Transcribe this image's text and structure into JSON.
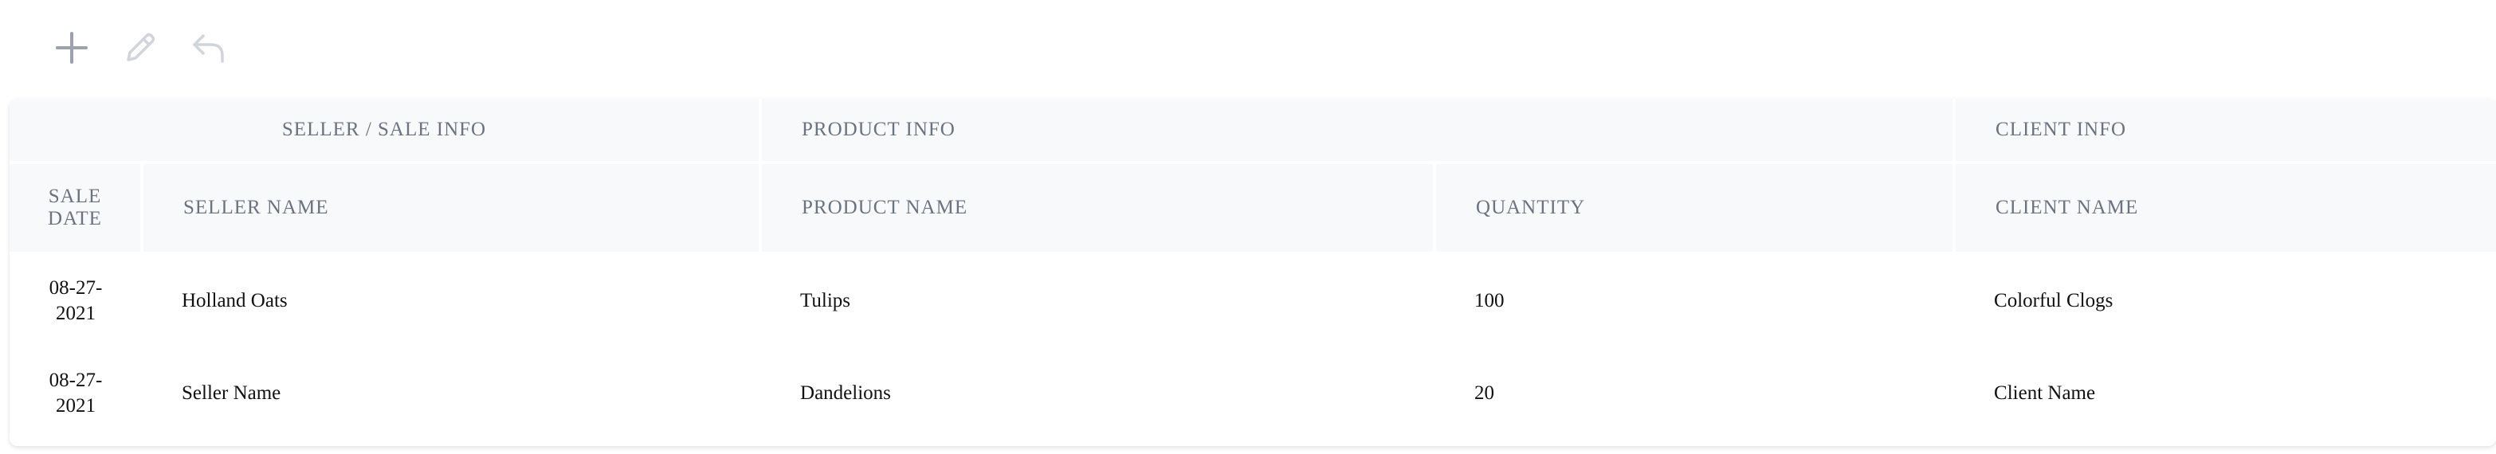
{
  "toolbar": {
    "add_icon": "plus-icon",
    "edit_icon": "pencil-icon",
    "undo_icon": "undo-icon"
  },
  "table": {
    "group_headers": {
      "seller": "SELLER / SALE INFO",
      "product": "PRODUCT INFO",
      "client": "CLIENT INFO"
    },
    "columns": {
      "sale_date": "SALE DATE",
      "seller_name": "SELLER NAME",
      "product_name": "PRODUCT NAME",
      "quantity": "QUANTITY",
      "client_name": "CLIENT NAME"
    },
    "rows": [
      {
        "sale_date": "08-27-2021",
        "seller_name": "Holland Oats",
        "product_name": "Tulips",
        "quantity": "100",
        "client_name": "Colorful Clogs"
      },
      {
        "sale_date": "08-27-2021",
        "seller_name": "Seller Name",
        "product_name": "Dandelions",
        "quantity": "20",
        "client_name": "Client Name"
      }
    ]
  },
  "colors": {
    "header_bg": "#f8f9fa",
    "header_text": "#6b7280",
    "icon_active": "#9ca3af",
    "icon_disabled": "#d1d5db"
  }
}
